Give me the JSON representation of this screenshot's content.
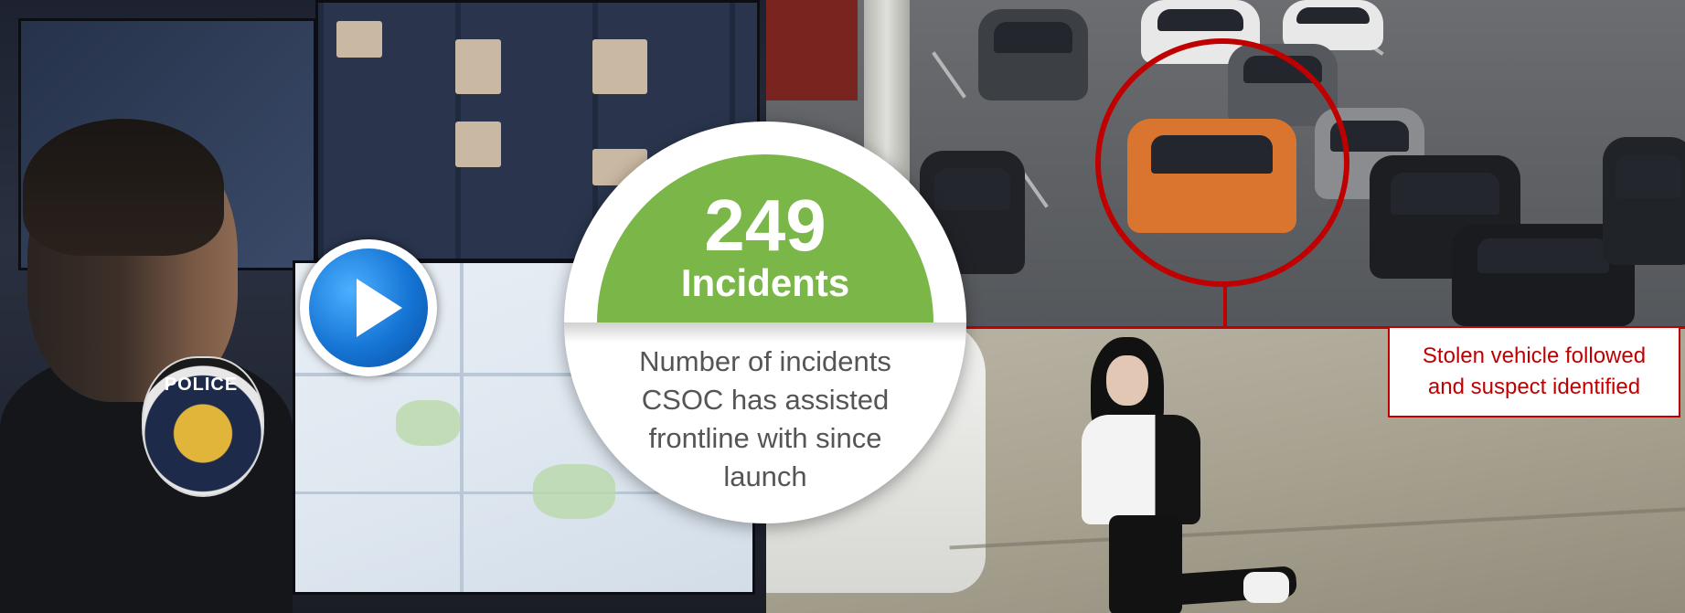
{
  "stat": {
    "number": "249",
    "unit_label": "Incidents",
    "description": "Number of incidents CSOC has assisted frontline with since launch"
  },
  "caption": {
    "text": "Stolen vehicle followed and suspect identified"
  },
  "badge_patch": {
    "text": "POLICE"
  },
  "icons": {
    "play": "play-icon"
  },
  "colors": {
    "accent_green": "#7ab648",
    "highlight_red": "#c00000",
    "play_blue": "#1574d4",
    "description_gray": "#555555"
  }
}
